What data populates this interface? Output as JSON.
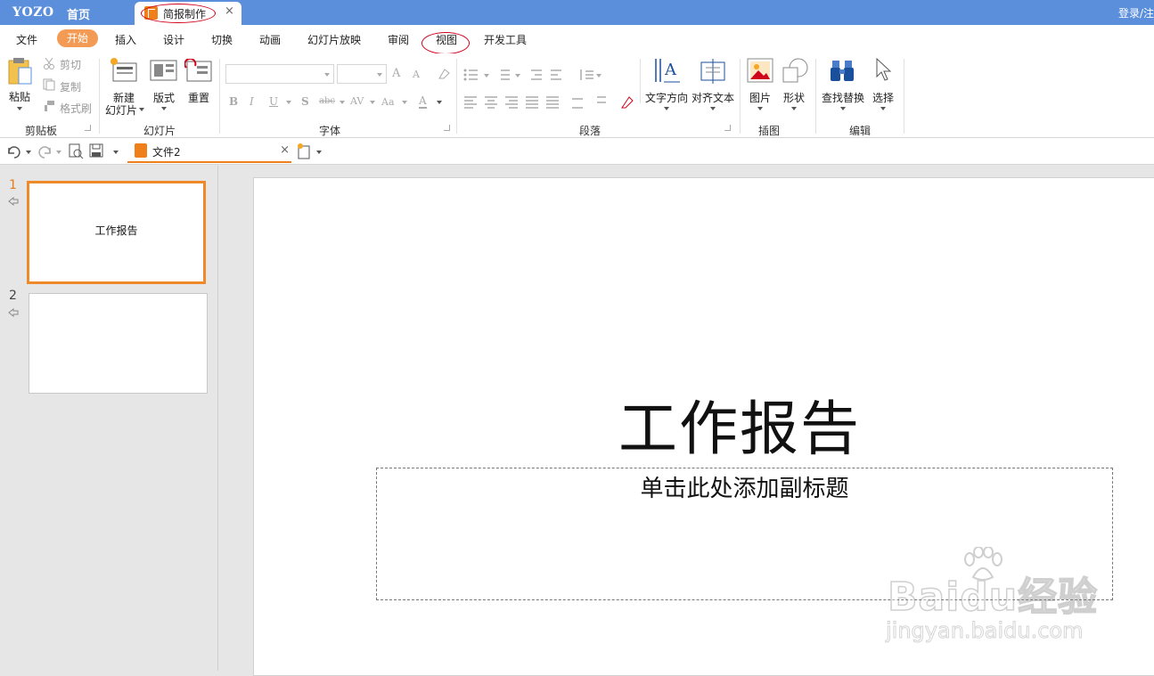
{
  "titlebar": {
    "logo": "YOZO",
    "home": "首页",
    "doc_tab": "简报制作",
    "close_glyph": "×",
    "login": "登录/注"
  },
  "menu": {
    "items": [
      "文件",
      "开始",
      "插入",
      "设计",
      "切换",
      "动画",
      "幻灯片放映",
      "审阅",
      "视图",
      "开发工具"
    ],
    "active": "开始",
    "active_color": "#f39a54"
  },
  "ribbon": {
    "clipboard": {
      "paste": "粘贴",
      "cut": "剪切",
      "copy": "复制",
      "format_painter": "格式刷",
      "group": "剪贴板"
    },
    "slides": {
      "new_slide_line1": "新建",
      "new_slide_line2": "幻灯片",
      "layout": "版式",
      "reset": "重置",
      "group": "幻灯片"
    },
    "font": {
      "bold": "B",
      "italic": "I",
      "underline": "U",
      "shadow": "S",
      "strike": "abc",
      "spacing": "AV",
      "case": "Aa",
      "color": "A",
      "grow": "A",
      "shrink": "A",
      "group": "字体"
    },
    "paragraph": {
      "group": "段落",
      "text_direction": "文字方向",
      "align_text": "对齐文本"
    },
    "illustration": {
      "picture": "图片",
      "shape": "形状",
      "group": "插图"
    },
    "edit": {
      "find_replace": "查找替换",
      "select": "选择",
      "group": "编辑"
    }
  },
  "quick_access": {
    "file_tab": "文件2",
    "close_glyph": "×"
  },
  "slides_panel": [
    {
      "number": "1",
      "title": "工作报告",
      "selected": true
    },
    {
      "number": "2",
      "title": "",
      "selected": false
    }
  ],
  "slide": {
    "title": "工作报告",
    "subtitle_placeholder": "单击此处添加副标题"
  },
  "watermark": {
    "brand": "Baidu经验",
    "url": "jingyan.baidu.com"
  },
  "colors": {
    "titlebar": "#5b8fdc",
    "accent_orange": "#ef8a2a",
    "annotation_red": "#d0021b"
  }
}
